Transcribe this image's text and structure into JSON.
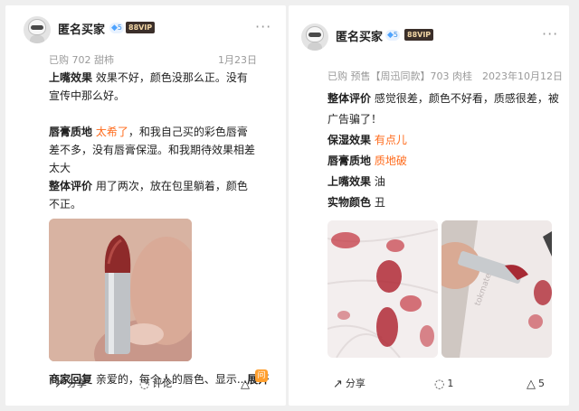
{
  "left": {
    "user": {
      "name": "匿名买家",
      "diamond_level": "5",
      "vip": "88VIP"
    },
    "meta": {
      "purchase": "已购 702 甜柿",
      "date": "1月23日"
    },
    "paragraphs": {
      "p1_label": "上嘴效果",
      "p1_text": " 效果不好，颜色没那么正。没有宣传中那么好。",
      "p2_label": "唇膏质地",
      "p2_highlight": " 太希了",
      "p2_text": "，和我自己买的彩色唇膏差不多，没有唇膏保湿。和我期待效果相差太大",
      "p3_label": "整体评价",
      "p3_text": " 用了两次，放在包里躺着，颜色不正。"
    },
    "reply": {
      "label": "商家回复",
      "text": " 亲爱的，每个人的唇色、显示...",
      "expand": "展开"
    },
    "actions": {
      "share": "分享",
      "comment": "评论",
      "ask_badge": "问"
    }
  },
  "right": {
    "user": {
      "name": "匿名买家",
      "diamond_level": "5",
      "vip": "88VIP"
    },
    "meta": {
      "purchase": "已购 预售【周迅同款】703 肉桂",
      "date": "2023年10月12日"
    },
    "paragraphs": {
      "p1_label": "整体评价",
      "p1_text": " 感觉很差，颜色不好看，质感很差，被广告骗了！",
      "p2_label": "保湿效果",
      "p2_highlight": " 有点儿",
      "p3_label": "唇膏质地",
      "p3_highlight": " 质地破",
      "p4_label": "上嘴效果",
      "p4_text": " 油",
      "p5_label": "实物颜色",
      "p5_text": " 丑"
    },
    "actions": {
      "share": "分享",
      "comment_count": "1",
      "like_count": "5"
    }
  },
  "icons": {
    "more": "more-dots-icon",
    "share": "share-icon",
    "comment": "comment-icon",
    "like": "like-icon",
    "diamond": "diamond-icon"
  },
  "colors": {
    "highlight": "#ff6a1a",
    "vip_bg": "#3b2f2a",
    "vip_text": "#f2d6a5",
    "diamond": "#4da3ff"
  }
}
